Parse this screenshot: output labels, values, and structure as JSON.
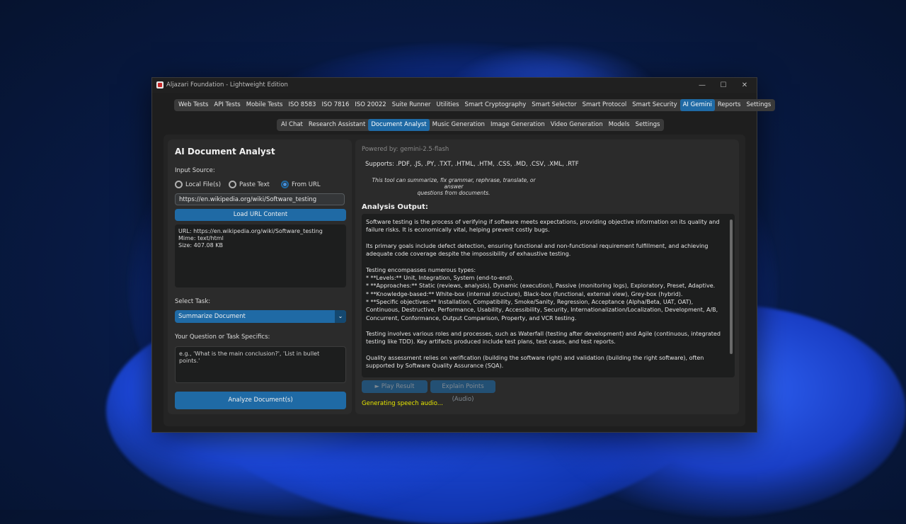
{
  "window": {
    "title": "Aljazari Foundation - Lightweight Edition",
    "controls": [
      "—",
      "☐",
      "✕"
    ]
  },
  "main_tabs": [
    {
      "label": "Web Tests",
      "active": false
    },
    {
      "label": "API Tests",
      "active": false
    },
    {
      "label": "Mobile Tests",
      "active": false
    },
    {
      "label": "ISO 8583",
      "active": false
    },
    {
      "label": "ISO 7816",
      "active": false
    },
    {
      "label": "ISO 20022",
      "active": false
    },
    {
      "label": "Suite Runner",
      "active": false
    },
    {
      "label": "Utilities",
      "active": false
    },
    {
      "label": "Smart Cryptography",
      "active": false
    },
    {
      "label": "Smart Selector",
      "active": false
    },
    {
      "label": "Smart Protocol",
      "active": false
    },
    {
      "label": "Smart Security",
      "active": false
    },
    {
      "label": "AI Gemini",
      "active": true
    },
    {
      "label": "Reports",
      "active": false
    },
    {
      "label": "Settings",
      "active": false
    }
  ],
  "sub_tabs": [
    {
      "label": "AI Chat",
      "active": false
    },
    {
      "label": "Research Assistant",
      "active": false
    },
    {
      "label": "Document Analyst",
      "active": true
    },
    {
      "label": "Music Generation",
      "active": false
    },
    {
      "label": "Image Generation",
      "active": false
    },
    {
      "label": "Video Generation",
      "active": false
    },
    {
      "label": "Models",
      "active": false
    },
    {
      "label": "Settings",
      "active": false
    }
  ],
  "left": {
    "title": "AI Document Analyst",
    "input_source_label": "Input Source:",
    "radio_local": "Local File(s)",
    "radio_paste": "Paste Text",
    "radio_url": "From URL",
    "selected_source": "From URL",
    "url_value": "https://en.wikipedia.org/wiki/Software_testing",
    "load_button": "Load URL Content",
    "info_lines": [
      "URL: https://en.wikipedia.org/wiki/Software_testing",
      "Mime: text/html",
      "Size: 407.08 KB"
    ],
    "select_task_label": "Select Task:",
    "task_value": "Summarize Document",
    "question_label": "Your Question or Task Specifics:",
    "question_placeholder": "e.g., 'What is the main conclusion?', 'List in bullet points.'",
    "analyze_button": "Analyze Document(s)"
  },
  "right": {
    "powered_by": "Powered by: gemini-2.5-flash",
    "supports": "Supports: .PDF, .JS, .PY, .TXT, .HTML, .HTM, .CSS, .MD, .CSV, .XML, .RTF",
    "note_line1": "This tool can summarize, fix grammar, rephrase, translate, or answer",
    "note_line2": "questions from documents.",
    "analysis_title": "Analysis Output:",
    "output_p1": "Software testing is the process of verifying if software meets expectations, providing objective information on its quality and failure risks. It is economically vital, helping prevent costly bugs.",
    "output_p2": "Its primary goals include defect detection, ensuring functional and non-functional requirement fulfillment, and achieving adequate code coverage despite the impossibility of exhaustive testing.",
    "output_p3_head": "Testing encompasses numerous types:",
    "output_p3_b1": "*    **Levels:** Unit, Integration, System (end-to-end).",
    "output_p3_b2": "*    **Approaches:** Static (reviews, analysis), Dynamic (execution), Passive (monitoring logs), Exploratory, Preset, Adaptive.",
    "output_p3_b3": "*    **Knowledge-based:** White-box (internal structure), Black-box (functional, external view), Grey-box (hybrid).",
    "output_p3_b4": "*    **Specific objectives:** Installation, Compatibility, Smoke/Sanity, Regression, Acceptance (Alpha/Beta, UAT, OAT), Continuous, Destructive, Performance, Usability, Accessibility, Security, Internationalization/Localization, Development, A/B, Concurrent, Conformance, Output Comparison, Property, and VCR testing.",
    "output_p4": "Testing involves various roles and processes, such as Waterfall (testing after development) and Agile (continuous, integrated testing like TDD). Key artifacts produced include test plans, test cases, and test reports.",
    "output_p5": "Quality assessment relies on verification (building the software right) and validation (building the right software), often supported by Software Quality Assurance (SQA).",
    "play_button": "► Play Result",
    "explain_button": "Explain Points (Audio)",
    "status": "Generating speech audio..."
  },
  "colors": {
    "accent": "#1f6aa5",
    "window_bg": "#1e1e1e",
    "panel_bg": "#2b2b2b",
    "status_text": "#e6e600"
  }
}
